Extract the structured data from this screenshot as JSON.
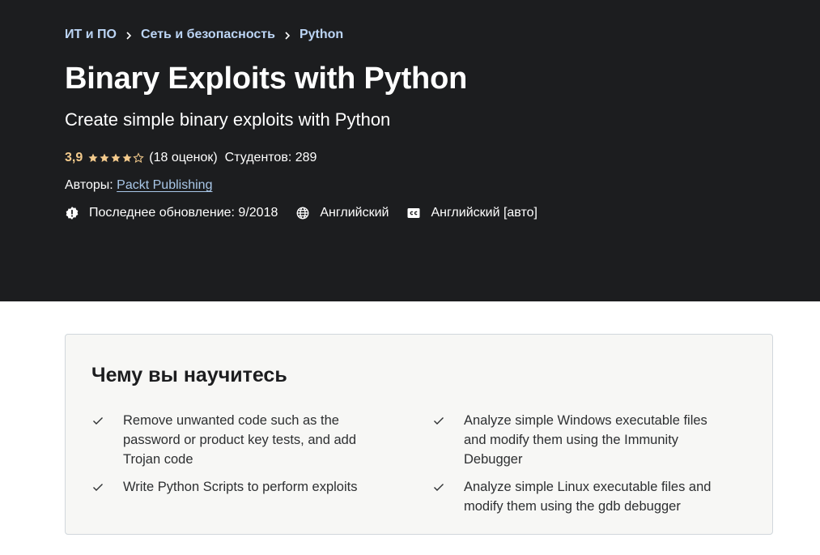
{
  "breadcrumb": [
    {
      "label": "ИТ и ПО"
    },
    {
      "label": "Сеть и безопасность"
    },
    {
      "label": "Python"
    }
  ],
  "course": {
    "title": "Binary Exploits with Python",
    "subtitle": "Create simple binary exploits with Python",
    "rating": "3,9",
    "rating_stars": 3.9,
    "rating_count": "(18 оценок)",
    "students": "Студентов: 289",
    "authors_label": "Авторы:",
    "author": "Packt Publishing",
    "last_updated": "Последнее обновление: 9/2018",
    "language": "Английский",
    "captions": "Английский [авто]"
  },
  "learn": {
    "title": "Чему вы научитесь",
    "left": [
      "Remove unwanted code such as the password or product key tests, and add Trojan code",
      "Write Python Scripts to perform exploits"
    ],
    "right": [
      "Analyze simple Windows executable files and modify them using the Immunity Debugger",
      "Analyze simple Linux executable files and modify them using the gdb debugger"
    ]
  },
  "colors": {
    "hero_bg": "#1c1d1f",
    "rating": "#f3ca8c",
    "link": "#a9c7e8",
    "box_bg": "#f7f7f5"
  },
  "icons": {
    "breadcrumb_separator": "chevron-right-icon",
    "last_updated": "alert-badge-icon",
    "language": "globe-icon",
    "captions": "closed-captions-icon",
    "learn_item": "checkmark-icon"
  }
}
